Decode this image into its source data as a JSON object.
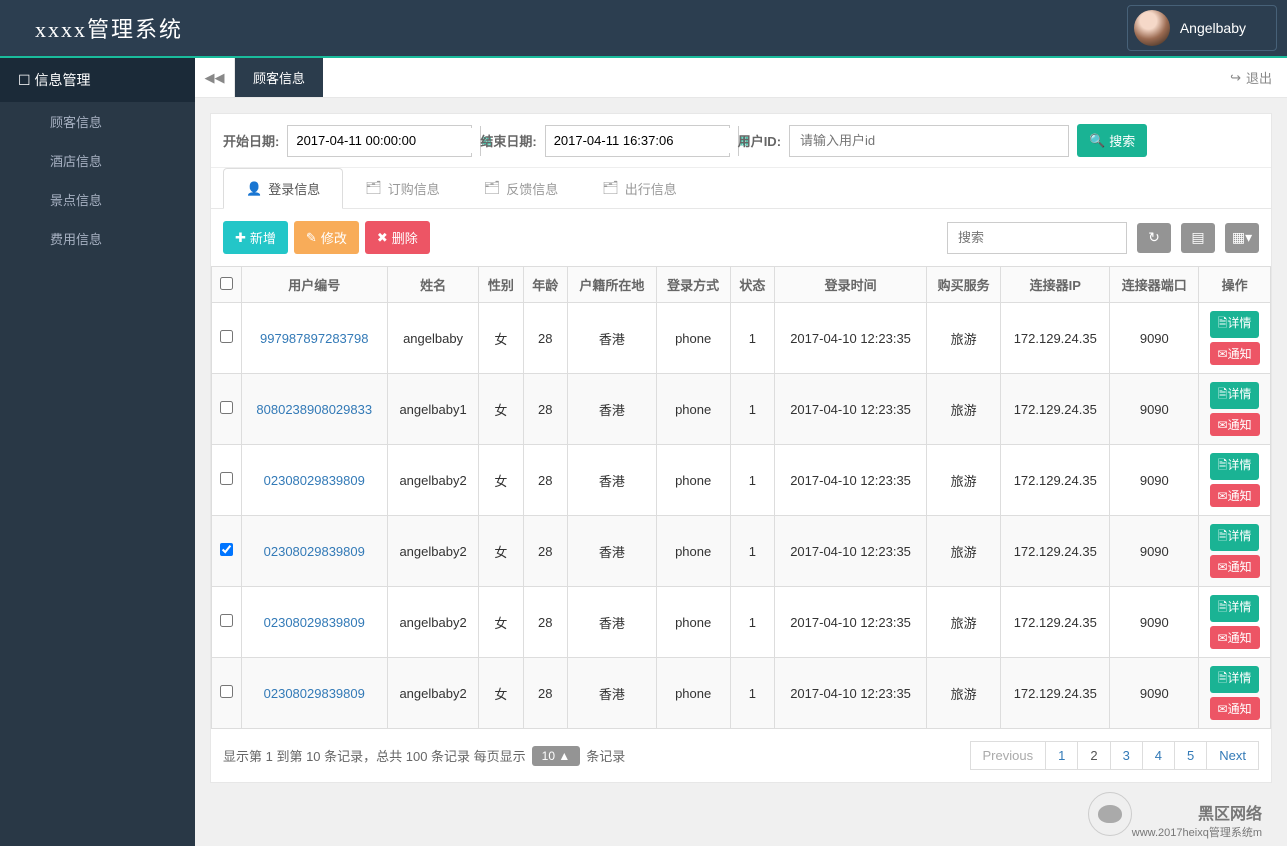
{
  "header": {
    "logo": "xxxx管理系统",
    "username": "Angelbaby"
  },
  "sidebar": {
    "title": "信息管理",
    "items": [
      "顾客信息",
      "酒店信息",
      "景点信息",
      "费用信息"
    ]
  },
  "tabbar": {
    "active": "顾客信息",
    "logout": "退出"
  },
  "filter": {
    "start_label": "开始日期:",
    "start_value": "2017-04-11 00:00:00",
    "end_label": "结束日期:",
    "end_value": "2017-04-11 16:37:06",
    "uid_label": "用户ID:",
    "uid_placeholder": "请输入用户id",
    "search_btn": "搜索"
  },
  "content_tabs": [
    "登录信息",
    "订购信息",
    "反馈信息",
    "出行信息"
  ],
  "toolbar": {
    "add": "新增",
    "edit": "修改",
    "del": "删除",
    "search_placeholder": "搜索"
  },
  "table": {
    "headers": [
      "用户编号",
      "姓名",
      "性别",
      "年龄",
      "户籍所在地",
      "登录方式",
      "状态",
      "登录时间",
      "购买服务",
      "连接器IP",
      "连接器端口",
      "操作"
    ],
    "rows": [
      {
        "checked": false,
        "uid": "997987897283798",
        "name": "angelbaby",
        "sex": "女",
        "age": "28",
        "loc": "香港",
        "method": "phone",
        "status": "1",
        "time": "2017-04-10 12:23:35",
        "svc": "旅游",
        "ip": "172.129.24.35",
        "port": "9090"
      },
      {
        "checked": false,
        "uid": "8080238908029833",
        "name": "angelbaby1",
        "sex": "女",
        "age": "28",
        "loc": "香港",
        "method": "phone",
        "status": "1",
        "time": "2017-04-10 12:23:35",
        "svc": "旅游",
        "ip": "172.129.24.35",
        "port": "9090"
      },
      {
        "checked": false,
        "uid": "02308029839809",
        "name": "angelbaby2",
        "sex": "女",
        "age": "28",
        "loc": "香港",
        "method": "phone",
        "status": "1",
        "time": "2017-04-10 12:23:35",
        "svc": "旅游",
        "ip": "172.129.24.35",
        "port": "9090"
      },
      {
        "checked": true,
        "uid": "02308029839809",
        "name": "angelbaby2",
        "sex": "女",
        "age": "28",
        "loc": "香港",
        "method": "phone",
        "status": "1",
        "time": "2017-04-10 12:23:35",
        "svc": "旅游",
        "ip": "172.129.24.35",
        "port": "9090"
      },
      {
        "checked": false,
        "uid": "02308029839809",
        "name": "angelbaby2",
        "sex": "女",
        "age": "28",
        "loc": "香港",
        "method": "phone",
        "status": "1",
        "time": "2017-04-10 12:23:35",
        "svc": "旅游",
        "ip": "172.129.24.35",
        "port": "9090"
      },
      {
        "checked": false,
        "uid": "02308029839809",
        "name": "angelbaby2",
        "sex": "女",
        "age": "28",
        "loc": "香港",
        "method": "phone",
        "status": "1",
        "time": "2017-04-10 12:23:35",
        "svc": "旅游",
        "ip": "172.129.24.35",
        "port": "9090"
      }
    ],
    "op_detail": "详情",
    "op_notify": "通知"
  },
  "pager": {
    "info_prefix": "显示第 1 到第 10 条记录，总共 100 条记录 每页显示",
    "size": "10 ▲",
    "info_suffix": "条记录",
    "prev": "Previous",
    "next": "Next",
    "pages": [
      "1",
      "2",
      "3",
      "4",
      "5"
    ],
    "active": "2"
  },
  "watermark": {
    "big": "黑区网络",
    "small": "www.2017heixq管理系统m"
  }
}
